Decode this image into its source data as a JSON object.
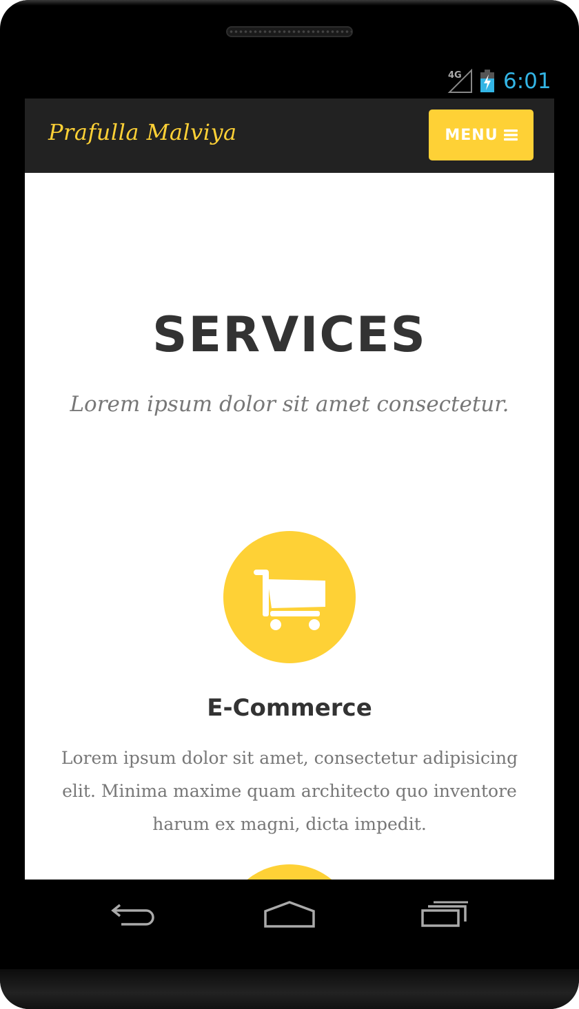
{
  "status_bar": {
    "network": "4G",
    "time": "6:01"
  },
  "navbar": {
    "brand": "Prafulla Malviya",
    "menu_label": "MENU"
  },
  "services": {
    "heading": "SERVICES",
    "subheading": "Lorem ipsum dolor sit amet consectetur.",
    "items": [
      {
        "icon": "shopping-cart-icon",
        "title": "E-Commerce",
        "text": "Lorem ipsum dolor sit amet, consectetur adipisicing elit. Minima maxime quam architecto quo inventore harum ex magni, dicta impedit."
      }
    ]
  },
  "colors": {
    "accent": "#fed136",
    "navbar_bg": "#222222",
    "heading": "#333333",
    "muted_text": "#777777",
    "clock": "#33b5e5"
  },
  "android_nav": [
    "back-icon",
    "home-icon",
    "recent-apps-icon"
  ]
}
